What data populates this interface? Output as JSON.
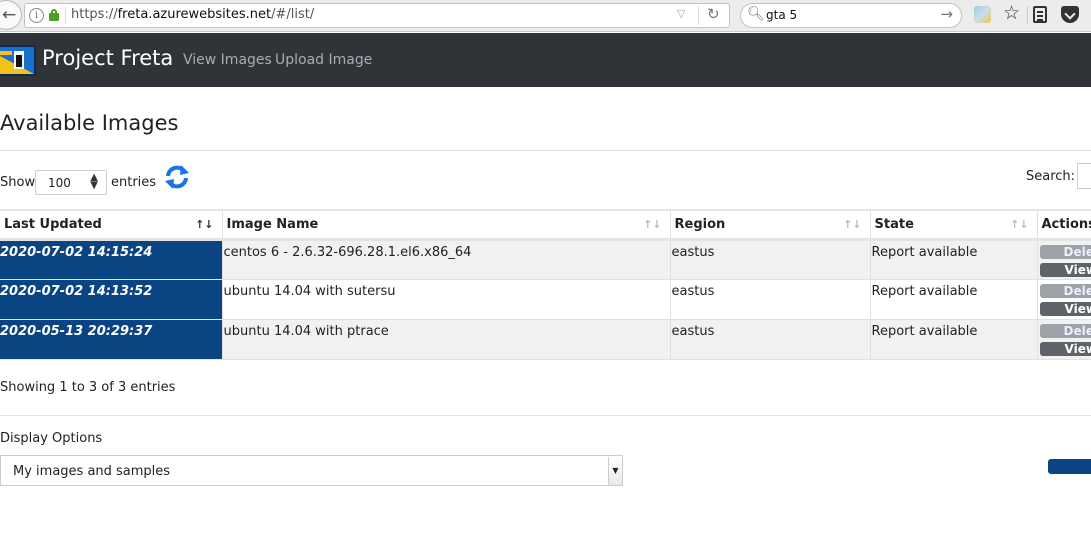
{
  "browser": {
    "url_prefix": "https://",
    "url_host": "freta.azurewebsites.net",
    "url_path": "/#/list/",
    "search_query": "gta 5"
  },
  "navbar": {
    "brand": "Project Freta",
    "links": [
      {
        "label": "View Images"
      },
      {
        "label": "Upload Image"
      }
    ]
  },
  "page": {
    "title": "Available Images",
    "show_label": "Show",
    "page_length": "100",
    "entries_label": "entries",
    "search_label": "Search:",
    "search_value": ""
  },
  "table": {
    "columns": [
      {
        "label": "Last Updated",
        "sort": "descending"
      },
      {
        "label": "Image Name",
        "sort": "none"
      },
      {
        "label": "Region",
        "sort": "none"
      },
      {
        "label": "State",
        "sort": "none"
      },
      {
        "label": "Actions"
      }
    ],
    "rows": [
      {
        "last_updated": "2020-07-02 14:15:24",
        "image_name": "centos 6 - 2.6.32-696.28.1.el6.x86_64",
        "region": "eastus",
        "state": "Report available",
        "delete_label": "Delete",
        "view_label": "View"
      },
      {
        "last_updated": "2020-07-02 14:13:52",
        "image_name": "ubuntu 14.04 with sutersu",
        "region": "eastus",
        "state": "Report available",
        "delete_label": "Delete",
        "view_label": "View"
      },
      {
        "last_updated": "2020-05-13 20:29:37",
        "image_name": "ubuntu 14.04 with ptrace",
        "region": "eastus",
        "state": "Report available",
        "delete_label": "Delete",
        "view_label": "View"
      }
    ],
    "info": "Showing 1 to 3 of 3 entries"
  },
  "display_options": {
    "label": "Display Options",
    "selected": "My images and samples"
  },
  "colors": {
    "navbar_bg": "#303337",
    "selected_cell_bg": "#0b4483",
    "refresh_icon": "#1a73e8",
    "delete_button": "#9ea1a5",
    "view_button": "#5e6369"
  }
}
